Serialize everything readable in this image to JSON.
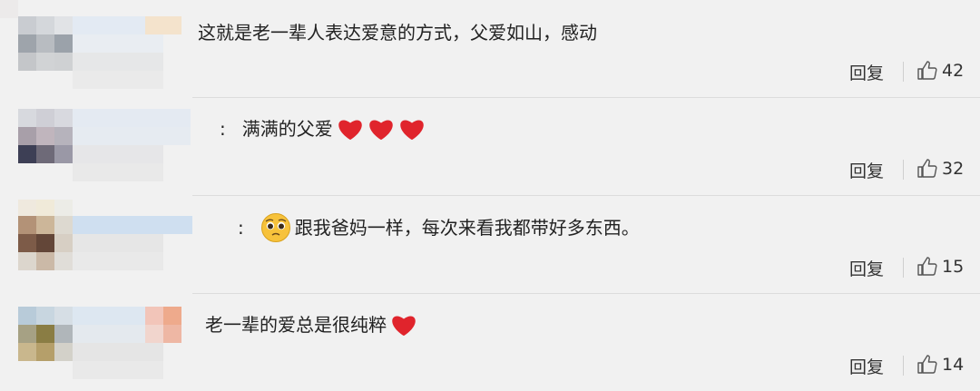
{
  "comments": [
    {
      "text": "这就是老一辈人表达爱意的方式，父爱如山，感动",
      "reply_label": "回复",
      "likes": "42",
      "hearts": 0
    },
    {
      "text": "满满的父爱",
      "reply_label": "回复",
      "likes": "32",
      "hearts": 3
    },
    {
      "text": "跟我爸妈一样，每次来看我都带好多东西。",
      "reply_label": "回复",
      "likes": "15",
      "hearts": 0
    },
    {
      "text": "老一辈的爱总是很纯粹",
      "reply_label": "回复",
      "likes": "14",
      "hearts": 1
    }
  ],
  "icons": {
    "like": "thumbs-up-icon",
    "heart": "red-heart-icon",
    "emoji": "pleading-face-icon"
  },
  "colors": {
    "background": "#f1f1f1",
    "heart": "#e0242c",
    "divider": "#dcdcdc"
  }
}
